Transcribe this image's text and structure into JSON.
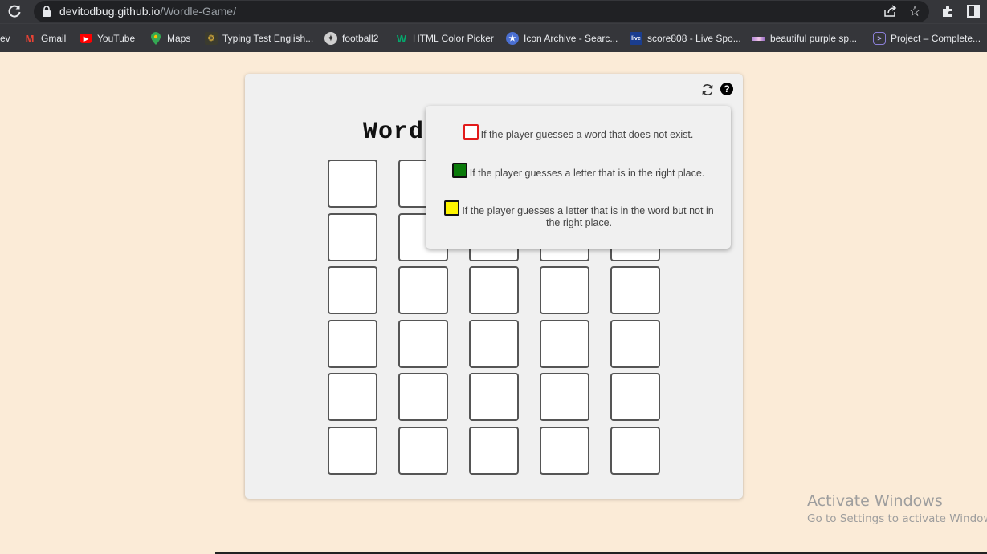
{
  "browser": {
    "url_host": "devitodbug.github.io",
    "url_path": "/Wordle-Game/",
    "bookmarks": [
      {
        "label": "ev",
        "icon": "none"
      },
      {
        "label": "Gmail",
        "icon": "gmail-icon",
        "color": "#ea4335"
      },
      {
        "label": "YouTube",
        "icon": "youtube-icon",
        "color": "#ff0000"
      },
      {
        "label": "Maps",
        "icon": "maps-icon",
        "color": "#34a853"
      },
      {
        "label": "Typing Test English...",
        "icon": "typing-test-icon",
        "color": "#c8a13a"
      },
      {
        "label": "football2",
        "icon": "football-icon",
        "color": "#cfcfcf"
      },
      {
        "label": "HTML Color Picker",
        "icon": "w3schools-icon",
        "color": "#04aa6d"
      },
      {
        "label": "Icon Archive - Searc...",
        "icon": "icon-archive-icon",
        "color": "#4a6fd1"
      },
      {
        "label": "score808 - Live Spo...",
        "icon": "score808-icon",
        "color": "#1a3d8f"
      },
      {
        "label": "beautiful purple sp...",
        "icon": "palette-icon",
        "color": "#b58bd9"
      },
      {
        "label": "Project – Complete...",
        "icon": "project-icon",
        "color": "#8a7fd6"
      }
    ]
  },
  "game": {
    "title": "Word",
    "rows": 6,
    "cols": 5
  },
  "help": {
    "rules": [
      {
        "swatch": "red",
        "text": "If the player guesses a word that does not exist."
      },
      {
        "swatch": "green",
        "text": "If the player guesses a letter that is in the right place."
      },
      {
        "swatch": "yellow",
        "text_line1": "If the player guesses a letter that is in the word but not in",
        "text_line2": "the right place."
      }
    ]
  },
  "os": {
    "watermark_title": "Activate Windows",
    "watermark_sub": "Go to Settings to activate Windows."
  },
  "colors": {
    "page_bg": "#fbebd7",
    "card_bg": "#f0f0f0",
    "invalid": "#e21b1b",
    "correct": "#0a7a0a",
    "present": "#fff500"
  }
}
